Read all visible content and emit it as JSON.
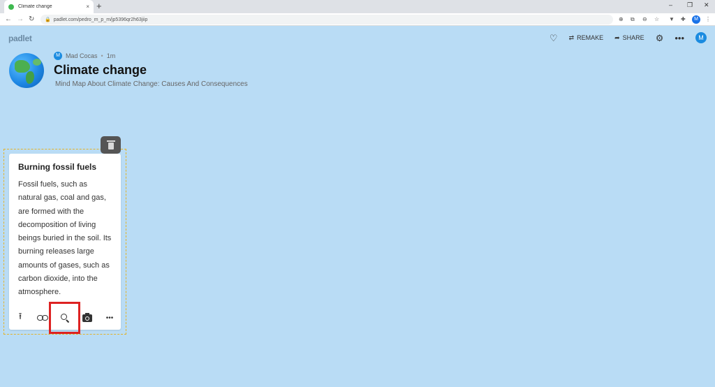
{
  "browser": {
    "tab_title": "Climate change",
    "tab_close": "×",
    "new_tab": "+",
    "url": "padlet.com/pedro_m_p_m/jp5396qr2h63jiip",
    "profile_initial": "M",
    "window_controls": {
      "minimize": "–",
      "maximize": "❐",
      "close": "✕"
    }
  },
  "header": {
    "logo": "padlet",
    "remake_label": "REMAKE",
    "share_label": "SHARE",
    "user_initial": "M"
  },
  "board": {
    "author_initial": "M",
    "author": "Mad Cocas",
    "time": "1m",
    "title": "Climate change",
    "description": "Mind Map About Climate Change: Causes And Consequences"
  },
  "post": {
    "title": "Burning fossil fuels",
    "body": "Fossil fuels, such as natural gas, coal and gas, are formed with the decomposition of living beings buried in the soil. Its burning releases large amounts of gases, such as carbon dioxide, into the atmosphere."
  },
  "colors": {
    "background": "#b9dcf5",
    "accent": "#1a8be0",
    "highlight": "#dd2222",
    "selection": "#e3b32a"
  }
}
